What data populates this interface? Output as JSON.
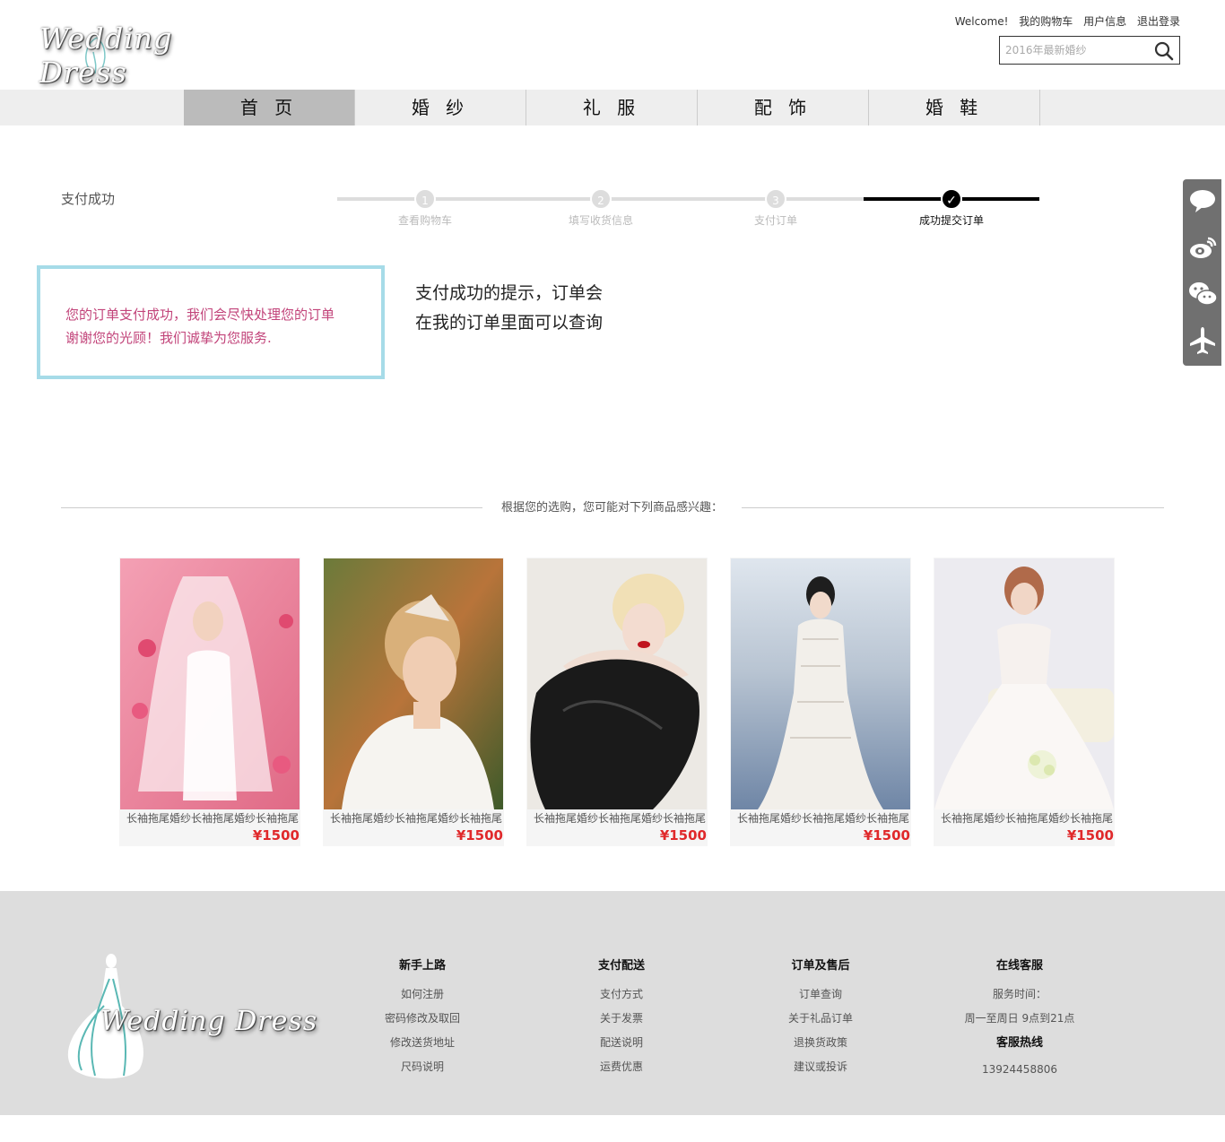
{
  "brand": {
    "logo_text": "Wedding Dress"
  },
  "top_links": {
    "welcome": "Welcome!",
    "cart": "我的购物车",
    "user_info": "用户信息",
    "logout": "退出登录"
  },
  "search": {
    "placeholder": "2016年最新婚纱"
  },
  "nav": [
    {
      "label": "首 页",
      "active": true
    },
    {
      "label": "婚 纱",
      "active": false
    },
    {
      "label": "礼 服",
      "active": false
    },
    {
      "label": "配 饰",
      "active": false
    },
    {
      "label": "婚 鞋",
      "active": false
    }
  ],
  "page_title": "支付成功",
  "steps": [
    {
      "num": "1",
      "label": "查看购物车",
      "done": false
    },
    {
      "num": "2",
      "label": "填写收货信息",
      "done": false
    },
    {
      "num": "3",
      "label": "支付订单",
      "done": false
    },
    {
      "num": "✓",
      "label": "成功提交订单",
      "done": true
    }
  ],
  "message": {
    "line1": "您的订单支付成功，我们会尽快处理您的订单",
    "line2": "谢谢您的光顾！我们诚挚为您服务."
  },
  "tip": {
    "line1": "支付成功的提示，订单会",
    "line2": "在我的订单里面可以查询"
  },
  "recommend_title": "根据您的选购，您可能对下列商品感兴趣：",
  "products": [
    {
      "name": "长袖拖尾婚纱长袖拖尾婚纱长袖拖尾",
      "price": "¥1500"
    },
    {
      "name": "长袖拖尾婚纱长袖拖尾婚纱长袖拖尾",
      "price": "¥1500"
    },
    {
      "name": "长袖拖尾婚纱长袖拖尾婚纱长袖拖尾",
      "price": "¥1500"
    },
    {
      "name": "长袖拖尾婚纱长袖拖尾婚纱长袖拖尾",
      "price": "¥1500"
    },
    {
      "name": "长袖拖尾婚纱长袖拖尾婚纱长袖拖尾",
      "price": "¥1500"
    }
  ],
  "side_tools": [
    "chat-icon",
    "weibo-icon",
    "wechat-icon",
    "plane-icon"
  ],
  "footer": {
    "logo_text": "Wedding Dress",
    "col1": {
      "title": "新手上路",
      "links": [
        "如何注册",
        "密码修改及取回",
        "修改送货地址",
        "尺码说明"
      ]
    },
    "col2": {
      "title": "支付配送",
      "links": [
        "支付方式",
        "关于发票",
        "配送说明",
        "运费优惠"
      ]
    },
    "col3": {
      "title": "订单及售后",
      "links": [
        "订单查询",
        "关于礼品订单",
        "退换货政策",
        "建议或投诉"
      ]
    },
    "col4": {
      "title": "在线客服",
      "service_time_label": "服务时间：",
      "service_time": "周一至周日 9点到21点",
      "hotline_title": "客服热线",
      "hotline": "13924458806"
    }
  },
  "colors": {
    "accent_pink": "#c2447a",
    "box_border": "#a6dbe8",
    "price_red": "#e0292b",
    "nav_bg": "#eeeeee",
    "nav_active": "#bbbbbb",
    "footer_bg": "#dddddd"
  }
}
